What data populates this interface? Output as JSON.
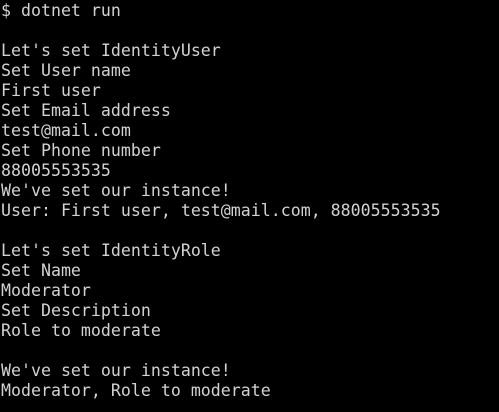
{
  "terminal": {
    "lines": [
      "$ dotnet run",
      "",
      "Let's set IdentityUser",
      "Set User name",
      "First user",
      "Set Email address",
      "test@mail.com",
      "Set Phone number",
      "88005553535",
      "We've set our instance!",
      "User: First user, test@mail.com, 88005553535",
      "",
      "Let's set IdentityRole",
      "Set Name",
      "Moderator",
      "Set Description",
      "Role to moderate",
      "",
      "We've set our instance!",
      "Moderator, Role to moderate"
    ]
  }
}
